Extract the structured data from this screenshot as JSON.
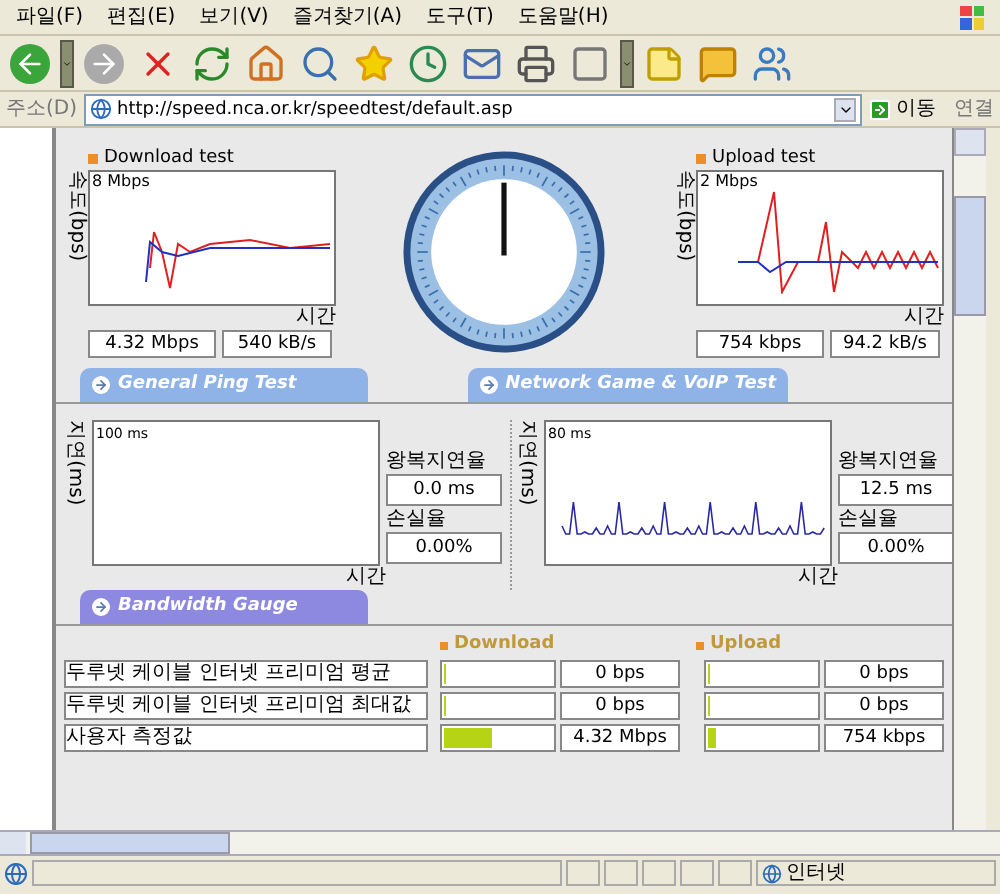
{
  "menu": [
    "파일(F)",
    "편집(E)",
    "보기(V)",
    "즐겨찾기(A)",
    "도구(T)",
    "도움말(H)"
  ],
  "address": {
    "label": "주소(D)",
    "url": "http://speed.nca.or.kr/speedtest/default.asp",
    "go": "이동",
    "links": "연결"
  },
  "speed_tests": [
    {
      "title": "Download test",
      "scale": "8 Mbps",
      "ylabel": "속도(bps)",
      "xlabel": "시간",
      "speed": "4.32 Mbps",
      "rate": "540 kB/s",
      "kind": "download"
    },
    {
      "title": "Upload test",
      "scale": "2 Mbps",
      "ylabel": "속도(bps)",
      "xlabel": "시간",
      "speed": "754 kbps",
      "rate": "94.2 kB/s",
      "kind": "upload"
    }
  ],
  "ping_tests": [
    {
      "tab": "General Ping Test",
      "scale": "100 ms",
      "ylabel": "지연(ms)",
      "xlabel": "시간",
      "delay_label": "왕복지연율",
      "delay": "0.0 ms",
      "loss_label": "손실율",
      "loss": "0.00%",
      "kind": "empty"
    },
    {
      "tab": "Network Game & VoIP Test",
      "scale": "80 ms",
      "ylabel": "지연(ms)",
      "xlabel": "시간",
      "delay_label": "왕복지연율",
      "delay": "12.5 ms",
      "loss_label": "손실율",
      "loss": "0.00%",
      "kind": "trace"
    }
  ],
  "bandwidth": {
    "tab": "Bandwidth Gauge",
    "headers": [
      "Download",
      "Upload"
    ],
    "rows": [
      {
        "label": "두루넷 케이블 인터넷 프리미엄 평균",
        "download": {
          "level": 0,
          "value": "0 bps"
        },
        "upload": {
          "level": 0,
          "value": "0 bps"
        }
      },
      {
        "label": "두루넷 케이블 인터넷 프리미엄 최대값",
        "download": {
          "level": 0,
          "value": "0 bps"
        },
        "upload": {
          "level": 0,
          "value": "0 bps"
        }
      },
      {
        "label": "사용자 측정값",
        "download": {
          "level": 0.44,
          "value": "4.32 Mbps"
        },
        "upload": {
          "level": 0.07,
          "value": "754 kbps"
        }
      }
    ]
  },
  "status_bar": {
    "zone": "인터넷"
  }
}
